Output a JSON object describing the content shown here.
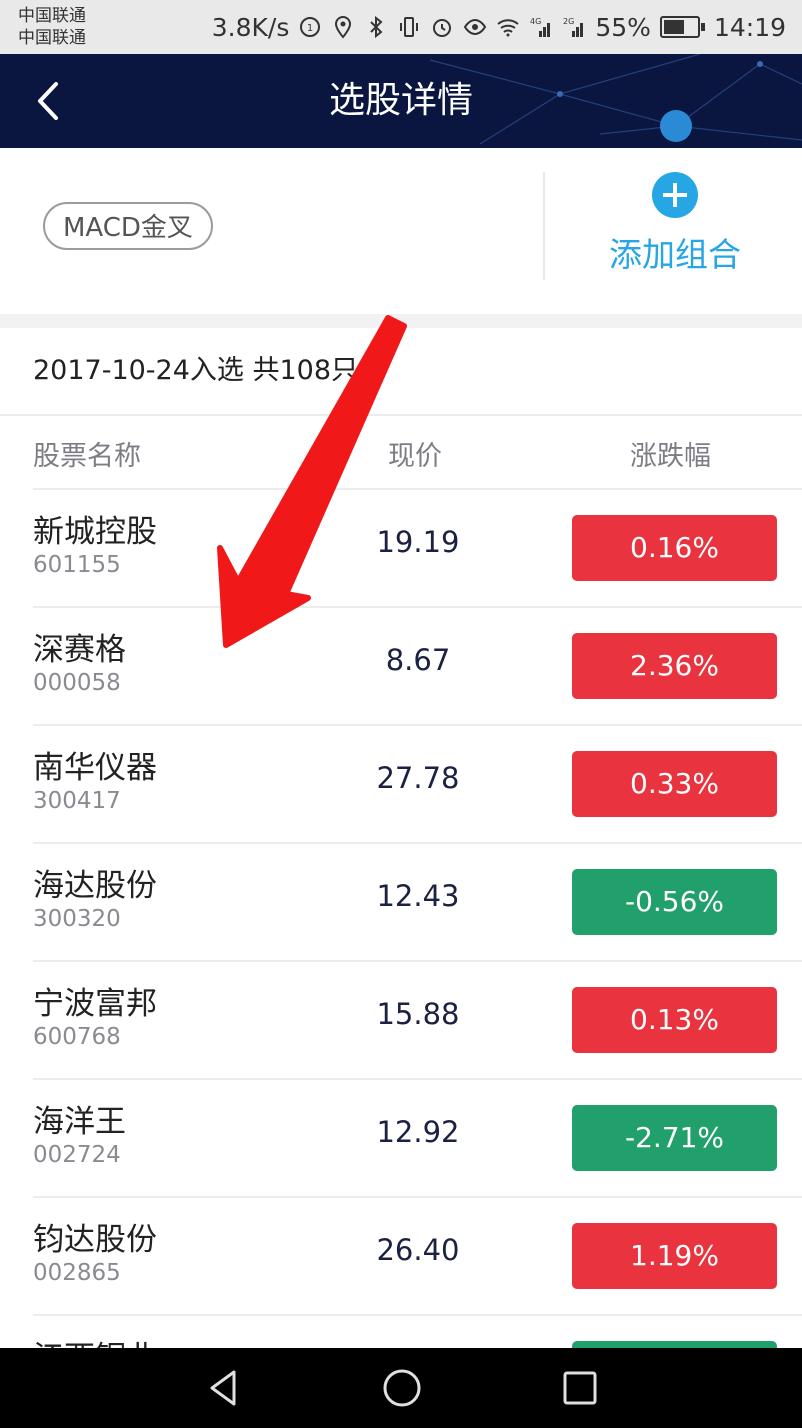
{
  "status_bar": {
    "carrier_1": "中国联通",
    "carrier_2": "中国联通",
    "net_speed": "3.8K/s",
    "battery": "55%",
    "time": "14:19",
    "net_4g": "4G",
    "net_2g": "2G"
  },
  "header": {
    "title": "选股详情"
  },
  "tag": {
    "label": "MACD金叉"
  },
  "add_group": {
    "label": "添加组合"
  },
  "summary": {
    "text": "2017-10-24入选 共108只"
  },
  "columns": {
    "name": "股票名称",
    "price": "现价",
    "change": "涨跌幅"
  },
  "stocks": [
    {
      "name": "新城控股",
      "code": "601155",
      "price": "19.19",
      "change": "0.16%",
      "direction": "up"
    },
    {
      "name": "深赛格",
      "code": "000058",
      "price": "8.67",
      "change": "2.36%",
      "direction": "up"
    },
    {
      "name": "南华仪器",
      "code": "300417",
      "price": "27.78",
      "change": "0.33%",
      "direction": "up"
    },
    {
      "name": "海达股份",
      "code": "300320",
      "price": "12.43",
      "change": "-0.56%",
      "direction": "down"
    },
    {
      "name": "宁波富邦",
      "code": "600768",
      "price": "15.88",
      "change": "0.13%",
      "direction": "up"
    },
    {
      "name": "海洋王",
      "code": "002724",
      "price": "12.92",
      "change": "-2.71%",
      "direction": "down"
    },
    {
      "name": "钧达股份",
      "code": "002865",
      "price": "26.40",
      "change": "1.19%",
      "direction": "up"
    },
    {
      "name": "江西铜业",
      "code": "",
      "price": "",
      "change": "",
      "direction": "down"
    }
  ],
  "colors": {
    "up": "#e9333f",
    "down": "#22a06b",
    "accent": "#26a6e4",
    "header_bg": "#0a1640"
  },
  "icons": [
    "back-arrow-icon",
    "plus-icon",
    "annotation-arrow-icon",
    "nav-back-icon",
    "nav-home-icon",
    "nav-recents-icon"
  ]
}
